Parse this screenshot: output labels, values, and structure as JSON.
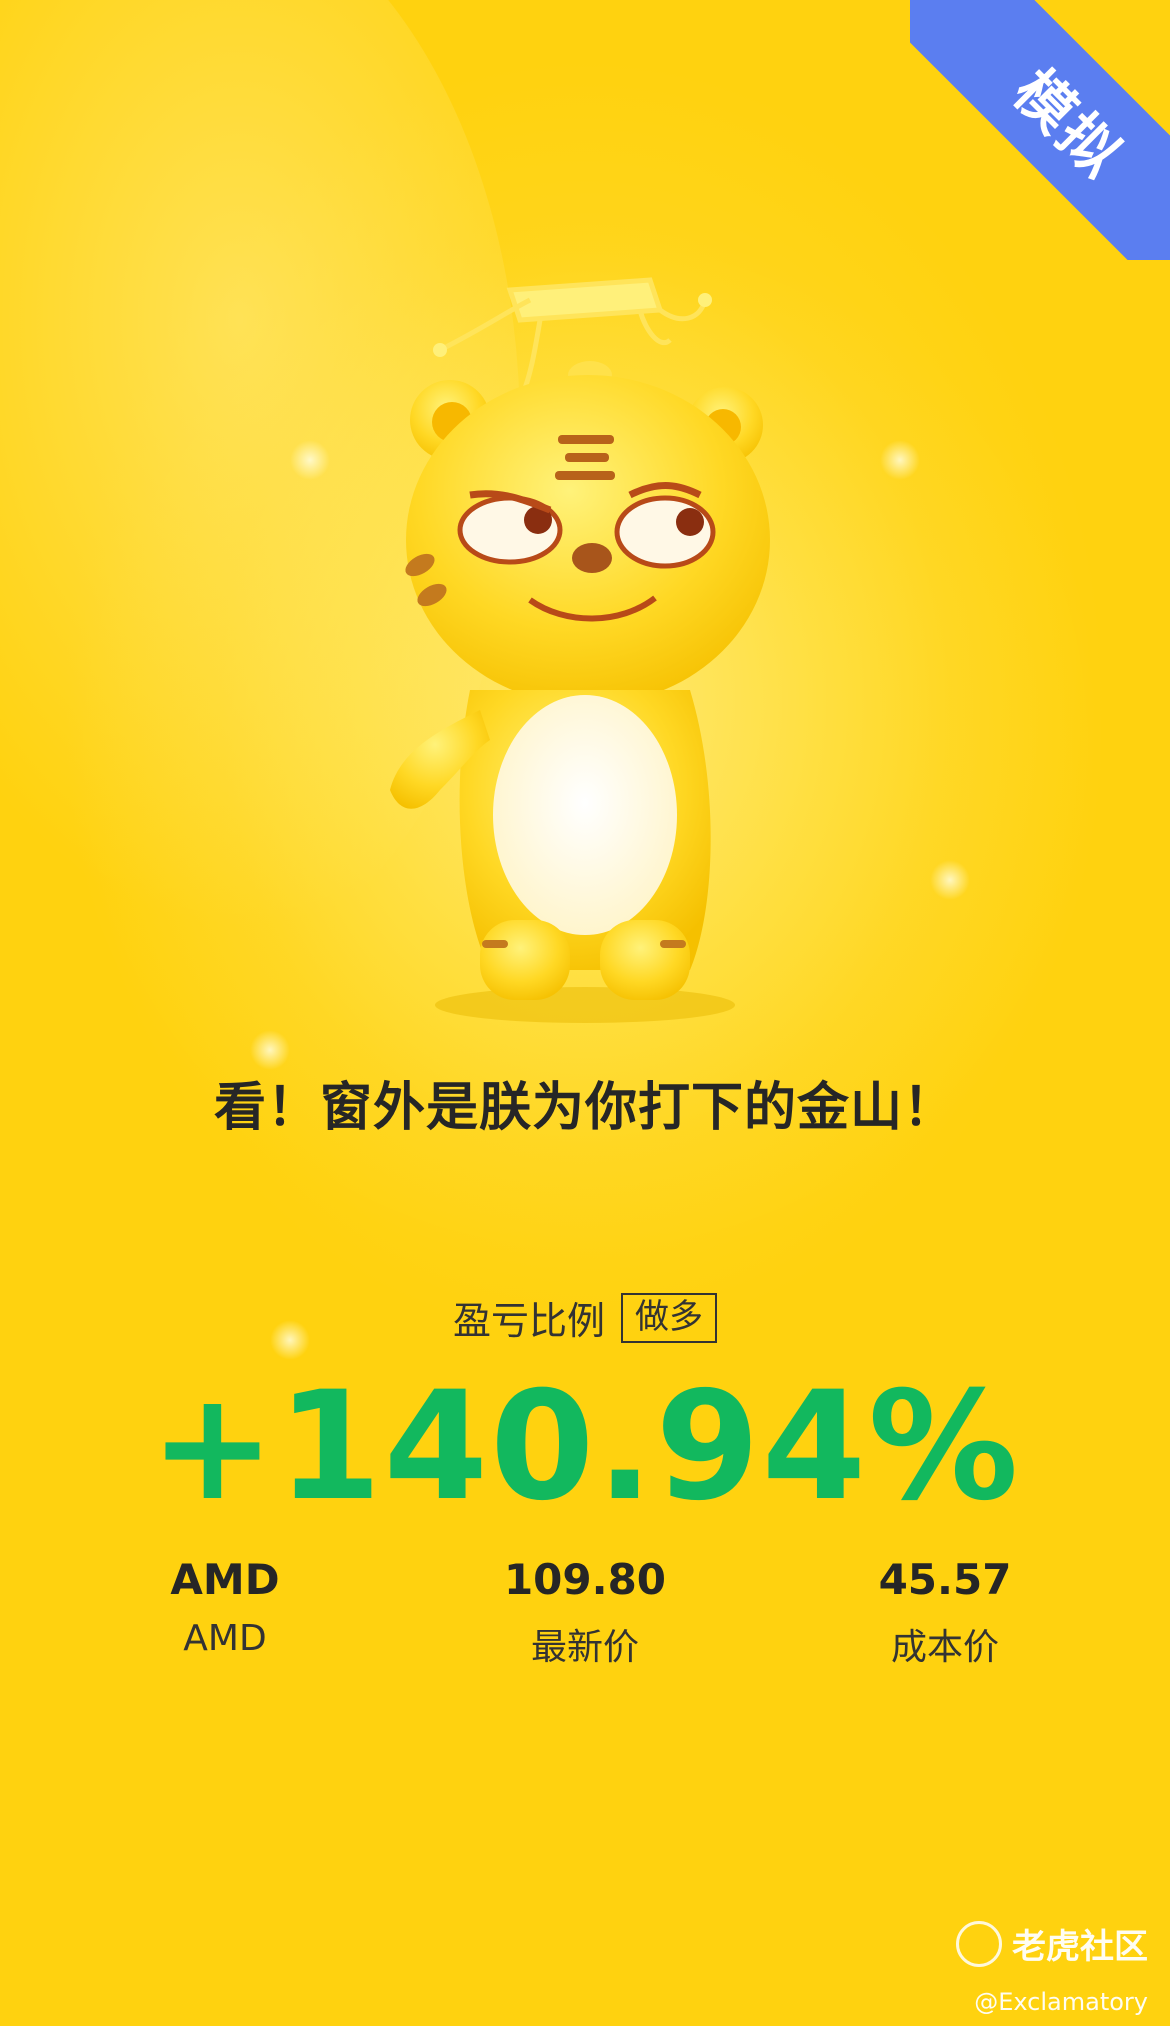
{
  "badge": {
    "label": "模拟"
  },
  "headline": "看！窗外是朕为你打下的金山！",
  "ratio": {
    "label": "盈亏比例",
    "direction": "做多",
    "value": "+140.94%"
  },
  "stats": [
    {
      "value": "AMD",
      "label": "AMD"
    },
    {
      "value": "109.80",
      "label": "最新价"
    },
    {
      "value": "45.57",
      "label": "成本价"
    }
  ],
  "watermark": {
    "brand": "老虎社区",
    "user": "@Exclamatory"
  },
  "colors": {
    "accent_green": "#12b85e",
    "ribbon_blue": "#5b7ef0",
    "background": "#ffd51b"
  },
  "icons": {
    "mascot": "tiger-mascot-icon",
    "watermark_logo": "tiger-community-logo-icon"
  }
}
